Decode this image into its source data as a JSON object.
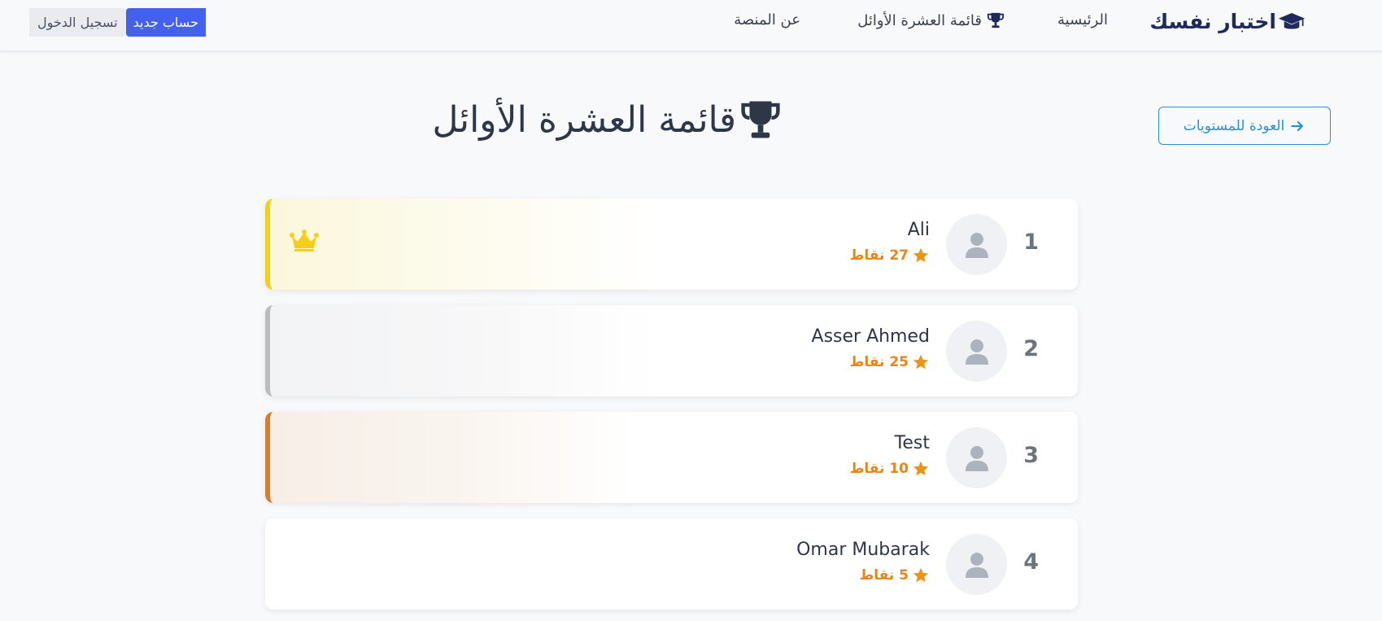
{
  "nav": {
    "brand": "اختبار نفسك",
    "links": [
      {
        "label": "الرئيسية"
      },
      {
        "label": "قائمة العشرة الأوائل"
      },
      {
        "label": "عن المنصة"
      }
    ],
    "login_label": "تسجيل الدخول",
    "register_label": "حساب جديد"
  },
  "header": {
    "title": "قائمة العشرة الأوائل",
    "back_label": "العودة للمستويات"
  },
  "leaderboard": [
    {
      "rank": "1",
      "name": "Ali",
      "score": "27 نقاط",
      "medal": "gold",
      "icon": "crown-icon"
    },
    {
      "rank": "2",
      "name": "Asser Ahmed",
      "score": "25 نقاط",
      "medal": "silver"
    },
    {
      "rank": "3",
      "name": "Test",
      "score": "10 نقاط",
      "medal": "bronze"
    },
    {
      "rank": "4",
      "name": "Omar Mubarak",
      "score": "5 نقاط",
      "medal": "none"
    }
  ],
  "colors": {
    "brand": "#1f2a5c",
    "primary": "#4361ee",
    "accent": "#2b8fd6",
    "gold": "#f6cf1c",
    "silver": "#bcbcbc",
    "bronze": "#d57d32",
    "score": "#e8851a"
  }
}
